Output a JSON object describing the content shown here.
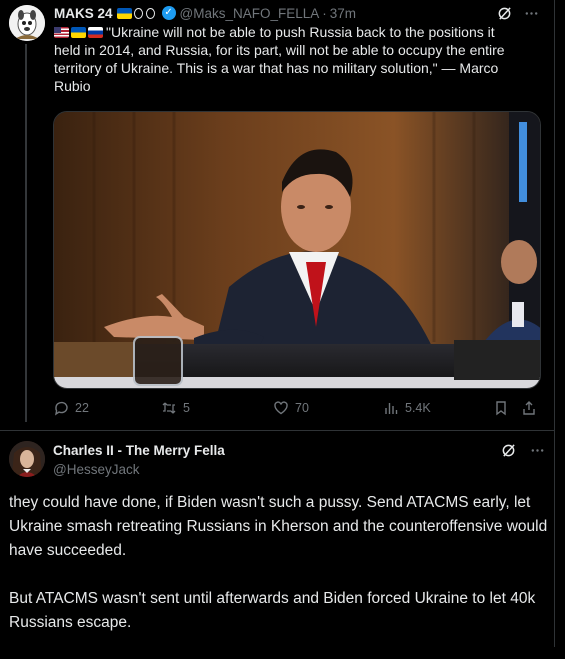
{
  "tweet": {
    "author_name": "MAKS 24",
    "author_handle": "@Maks_NAFO_FELLA",
    "separator": "·",
    "timestamp": "37m",
    "text": "\"Ukraine will not be able to push Russia back to the positions it held in 2014, and Russia, for its part, will not be able to occupy the entire territory of Ukraine. This is a war that has no military solution,\" — Marco Rubio",
    "image_alt": "photo",
    "stats": {
      "replies": "22",
      "reposts": "5",
      "likes": "70",
      "views": "5.4K"
    },
    "icons": [
      "grok-icon",
      "more-icon",
      "reply-icon",
      "repost-icon",
      "like-icon",
      "views-icon",
      "bookmark-icon",
      "share-icon"
    ]
  },
  "reply": {
    "author_name": "Charles II - The Merry Fella",
    "author_handle": "@HesseyJack",
    "paragraphs": [
      "they could have done, if Biden wasn't such a pussy. Send ATACMS early, let Ukraine smash retreating Russians in Kherson and the counteroffensive would have succeeded.",
      "But ATACMS wasn't sent until afterwards and Biden forced Ukraine to let 40k Russians escape."
    ]
  },
  "colors": {
    "background": "#000000",
    "text": "#e7e9ea",
    "muted": "#71767b",
    "divider": "#2f3336",
    "verified": "#1d9bf0"
  }
}
